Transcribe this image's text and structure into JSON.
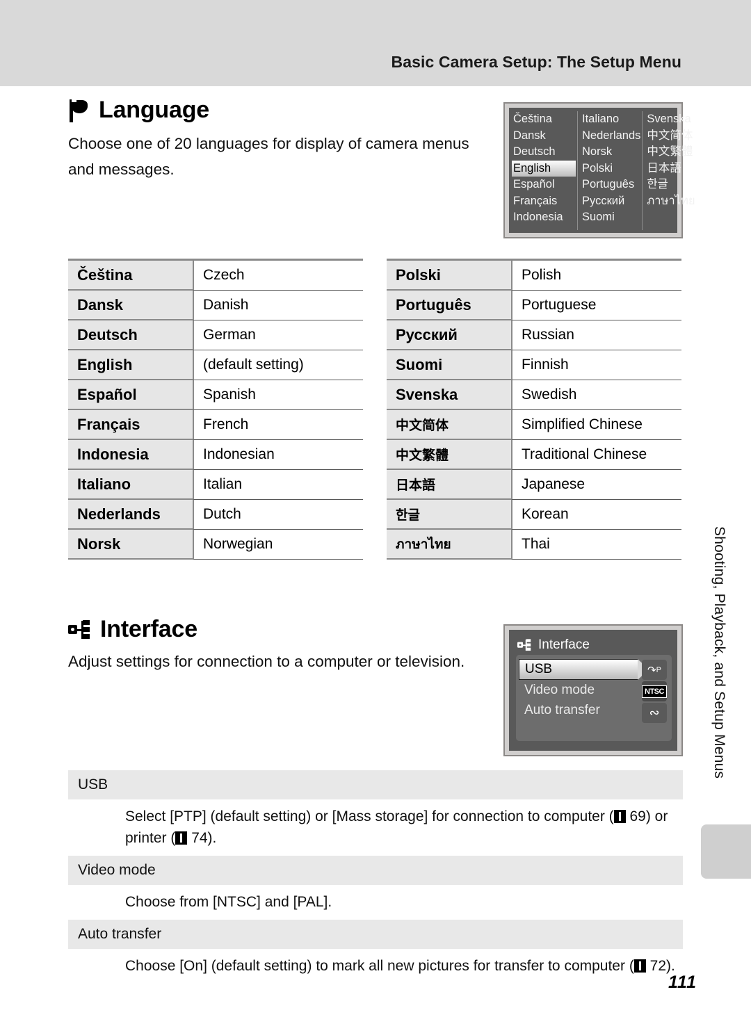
{
  "header": {
    "title": "Basic Camera Setup: The Setup Menu"
  },
  "side_tab": {
    "label": "Shooting, Playback, and Setup Menus"
  },
  "page_number": "111",
  "language_section": {
    "icon": "flag-icon",
    "title": "Language",
    "description": "Choose one of 20 languages for display of camera menus and messages.",
    "camera_screen": {
      "columns": [
        [
          "Čeština",
          "Dansk",
          "Deutsch",
          "English",
          "Español",
          "Français",
          "Indonesia"
        ],
        [
          "Italiano",
          "Nederlands",
          "Norsk",
          "Polski",
          "Português",
          "Русский",
          "Suomi"
        ],
        [
          "Svenska",
          "中文简体",
          "中文繁體",
          "日本語",
          "한글",
          "ภาษาไทย"
        ]
      ],
      "selected": "English"
    },
    "table_left": [
      {
        "native": "Čeština",
        "english": "Czech"
      },
      {
        "native": "Dansk",
        "english": "Danish"
      },
      {
        "native": "Deutsch",
        "english": "German"
      },
      {
        "native": "English",
        "english": "(default setting)"
      },
      {
        "native": "Español",
        "english": "Spanish"
      },
      {
        "native": "Français",
        "english": "French"
      },
      {
        "native": "Indonesia",
        "english": "Indonesian"
      },
      {
        "native": "Italiano",
        "english": "Italian"
      },
      {
        "native": "Nederlands",
        "english": "Dutch"
      },
      {
        "native": "Norsk",
        "english": "Norwegian"
      }
    ],
    "table_right": [
      {
        "native": "Polski",
        "english": "Polish"
      },
      {
        "native": "Português",
        "english": "Portuguese"
      },
      {
        "native": "Русский",
        "english": "Russian"
      },
      {
        "native": "Suomi",
        "english": "Finnish"
      },
      {
        "native": "Svenska",
        "english": "Swedish"
      },
      {
        "native": "中文简体",
        "english": "Simplified Chinese"
      },
      {
        "native": "中文繁體",
        "english": "Traditional Chinese"
      },
      {
        "native": "日本語",
        "english": "Japanese"
      },
      {
        "native": "한글",
        "english": "Korean"
      },
      {
        "native": "ภาษาไทย",
        "english": "Thai"
      }
    ]
  },
  "interface_section": {
    "icon": "interface-icon",
    "title": "Interface",
    "description": "Adjust settings for connection to a computer or television.",
    "camera_screen": {
      "title": "Interface",
      "items": [
        "USB",
        "Video mode",
        "Auto transfer"
      ],
      "selected": "USB",
      "right_icons": [
        "usb-ptp-icon",
        "ntsc-icon",
        "auto-transfer-icon"
      ],
      "ntsc_label": "NTSC"
    },
    "descriptions": [
      {
        "heading": "USB",
        "text_parts": [
          "Select [PTP] (default setting) or [Mass storage] for connection to computer (",
          " 69) or printer (",
          " 74)."
        ],
        "refs": [
          "69",
          "74"
        ]
      },
      {
        "heading": "Video mode",
        "text_parts": [
          "Choose from [NTSC] and [PAL]."
        ],
        "refs": []
      },
      {
        "heading": "Auto transfer",
        "text_parts": [
          "Choose [On] (default setting) to mark all new pictures for transfer to computer (",
          " 72)."
        ],
        "refs": [
          "72"
        ]
      }
    ]
  },
  "colors": {
    "header_band": "#d9d9d9",
    "table_native_bg": "#e6e6e6",
    "rule": "#8a8a8a",
    "camera_bg": "#595959",
    "desc_heading_bg": "#e8e8e8"
  }
}
